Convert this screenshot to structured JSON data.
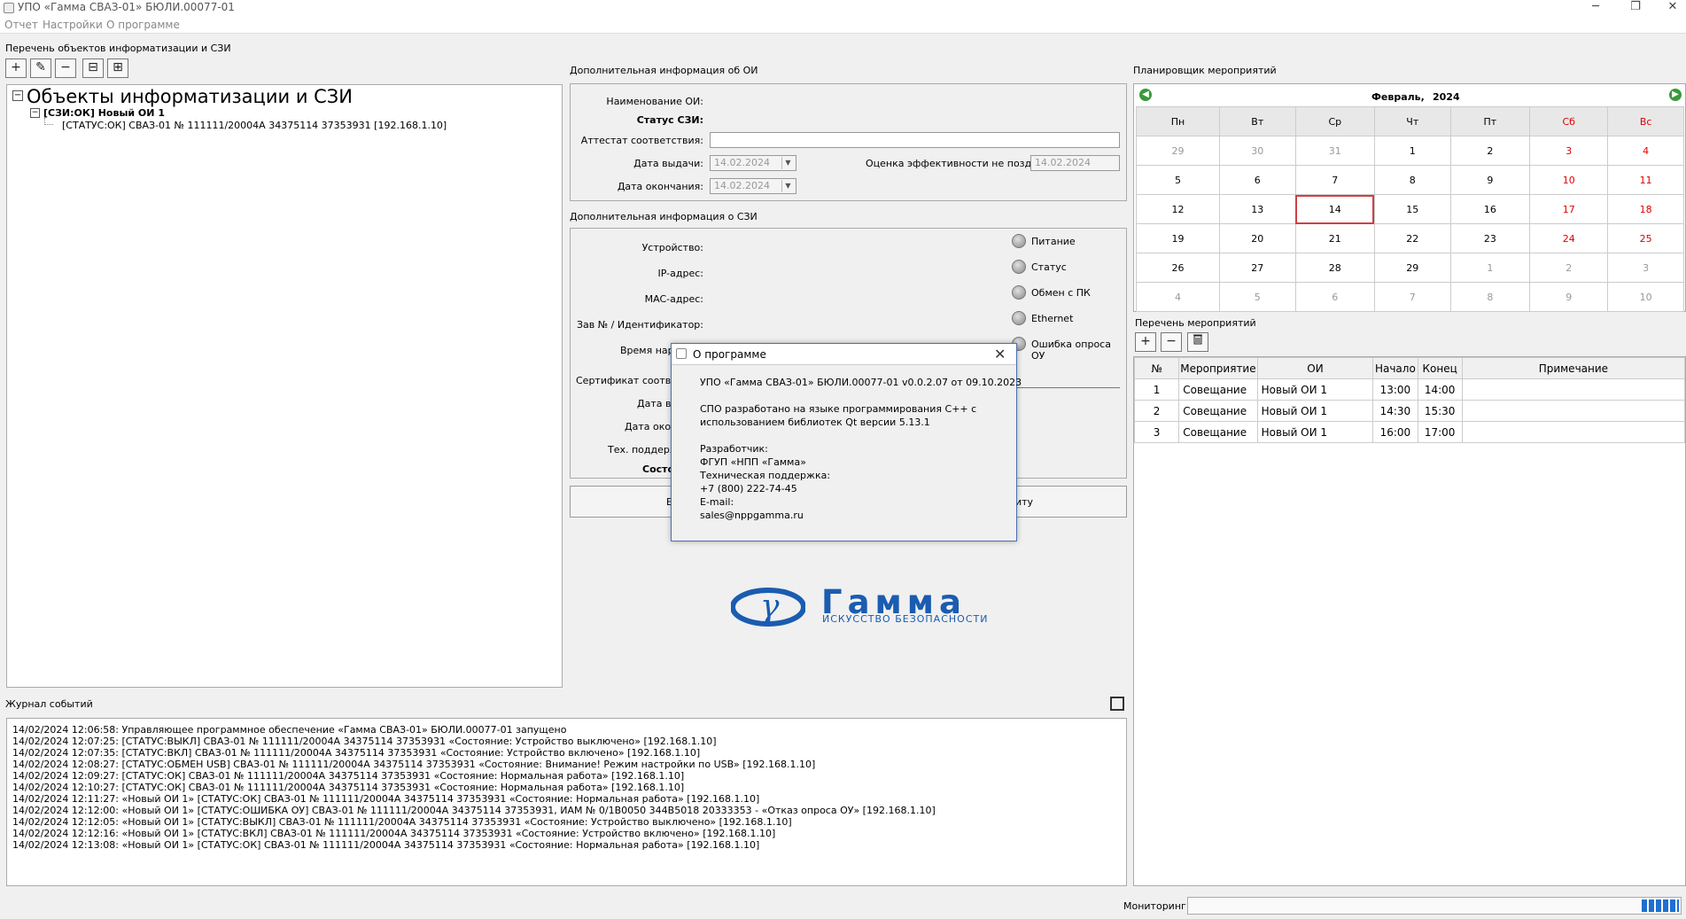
{
  "window": {
    "title": "УПО «Гамма СВАЗ-01» БЮЛИ.00077-01"
  },
  "menu": [
    "Отчет",
    "Настройки",
    "О программе"
  ],
  "left_panel": {
    "title": "Перечень объектов информатизации и СЗИ",
    "tree_root": "Объекты информатизации и СЗИ",
    "tree_child": "[СЗИ:ОК] Новый ОИ 1",
    "tree_leaf": "[СТАТУС:ОК] СВАЗ-01 № 111111/20004A 34375114 37353931 [192.168.1.10]"
  },
  "oi_info": {
    "title": "Дополнительная информация об ОИ",
    "name_label": "Наименование ОИ:",
    "status_label": "Статус СЗИ:",
    "attest_label": "Аттестат соответствия:",
    "issue_label": "Дата выдачи:",
    "issue_value": "14.02.2024",
    "end_label": "Дата окончания:",
    "end_value": "14.02.2024",
    "eff_label": "Оценка эффективности не позднее:",
    "eff_value": "14.02.2024"
  },
  "szi_info": {
    "title": "Дополнительная информация о СЗИ",
    "device_label": "Устройство:",
    "ip_label": "IP-адрес:",
    "mac_label": "MAC-адрес:",
    "serial_label": "Зав № / Идентификатор:",
    "time_label": "Время нара",
    "cert_label": "Сертификат соответ",
    "date1_label": "Дата вы",
    "date2_label": "Дата окон",
    "support_label": "Тех. поддерж",
    "state_label": "Состо",
    "indicators": [
      "Питание",
      "Статус",
      "Обмен с ПК",
      "Ethernet",
      "Ошибка опроса ОУ"
    ],
    "btn_left": "Е",
    "btn_right": "иту"
  },
  "logo": {
    "name": "Гамма",
    "tagline": "ИСКУССТВО БЕЗОПАСНОСТИ"
  },
  "planner": {
    "title": "Планировщик мероприятий",
    "month": "Февраль,",
    "year": "2024",
    "weekdays": [
      "Пн",
      "Вт",
      "Ср",
      "Чт",
      "Пт",
      "Сб",
      "Вс"
    ],
    "weeks": [
      [
        "29",
        "30",
        "31",
        "1",
        "2",
        "3",
        "4"
      ],
      [
        "5",
        "6",
        "7",
        "8",
        "9",
        "10",
        "11"
      ],
      [
        "12",
        "13",
        "14",
        "15",
        "16",
        "17",
        "18"
      ],
      [
        "19",
        "20",
        "21",
        "22",
        "23",
        "24",
        "25"
      ],
      [
        "26",
        "27",
        "28",
        "29",
        "1",
        "2",
        "3"
      ],
      [
        "4",
        "5",
        "6",
        "7",
        "8",
        "9",
        "10"
      ]
    ],
    "selected": "14",
    "events_title": "Перечень мероприятий",
    "columns": [
      "№",
      "Мероприятие",
      "ОИ",
      "Начало",
      "Конец",
      "Примечание"
    ],
    "events": [
      [
        "1",
        "Совещание",
        "Новый ОИ 1",
        "13:00",
        "14:00",
        ""
      ],
      [
        "2",
        "Совещание",
        "Новый ОИ 1",
        "14:30",
        "15:30",
        ""
      ],
      [
        "3",
        "Совещание",
        "Новый ОИ 1",
        "16:00",
        "17:00",
        ""
      ]
    ]
  },
  "log": {
    "title": "Журнал событий",
    "lines": [
      "14/02/2024 12:06:58: Управляющее программное обеспечение «Гамма СВАЗ-01» БЮЛИ.00077-01 запущено",
      "14/02/2024 12:07:25: [СТАТУС:ВЫКЛ] СВАЗ-01 № 111111/20004A 34375114 37353931 «Состояние: Устройство выключено» [192.168.1.10]",
      "14/02/2024 12:07:35: [СТАТУС:ВКЛ] СВАЗ-01 № 111111/20004A 34375114 37353931 «Состояние: Устройство включено» [192.168.1.10]",
      "14/02/2024 12:08:27: [СТАТУС:ОБМЕН USB] СВАЗ-01 № 111111/20004A 34375114 37353931 «Состояние: Внимание! Режим настройки по USB» [192.168.1.10]",
      "14/02/2024 12:09:27: [СТАТУС:ОК] СВАЗ-01 № 111111/20004A 34375114 37353931 «Состояние: Нормальная работа» [192.168.1.10]",
      "14/02/2024 12:10:27: [СТАТУС:ОК] СВАЗ-01 № 111111/20004A 34375114 37353931 «Состояние: Нормальная работа» [192.168.1.10]",
      "14/02/2024 12:11:27: «Новый ОИ 1» [СТАТУС:ОК] СВАЗ-01 № 111111/20004A 34375114 37353931 «Состояние: Нормальная работа» [192.168.1.10]",
      "14/02/2024 12:12:00: «Новый ОИ 1» [СТАТУС:ОШИБКА ОУ] СВАЗ-01 № 111111/20004A 34375114 37353931, ИАМ № 0/1B0050 344B5018 20333353  - «Отказ опроса ОУ» [192.168.1.10]",
      "14/02/2024 12:12:05: «Новый ОИ 1» [СТАТУС:ВЫКЛ] СВАЗ-01 № 111111/20004A 34375114 37353931 «Состояние: Устройство выключено» [192.168.1.10]",
      "14/02/2024 12:12:16: «Новый ОИ 1» [СТАТУС:ВКЛ] СВАЗ-01 № 111111/20004A 34375114 37353931 «Состояние: Устройство включено» [192.168.1.10]",
      "14/02/2024 12:13:08: «Новый ОИ 1» [СТАТУС:ОК] СВАЗ-01 № 111111/20004A 34375114 37353931 «Состояние: Нормальная работа» [192.168.1.10]"
    ]
  },
  "status": {
    "monitor_label": "Мониторинг:"
  },
  "about": {
    "title": "О программе",
    "version": "УПО «Гамма СВАЗ-01» БЮЛИ.00077-01 v0.0.2.07 от 09.10.2023",
    "desc1": "СПО разработано на языке программирования C++ с",
    "desc2": "использованием библиотек Qt версии 5.13.1",
    "dev_label": "Разработчик:",
    "dev": "ФГУП «НПП «Гамма»",
    "support_label": "Техническая поддержка:",
    "phone": "+7 (800) 222-74-45",
    "email_label": "E-mail:",
    "email": "sales@nppgamma.ru"
  },
  "colors": {
    "weekend": "#e00000",
    "selected_border": "#d04040",
    "progress": "#1e6fd0"
  }
}
